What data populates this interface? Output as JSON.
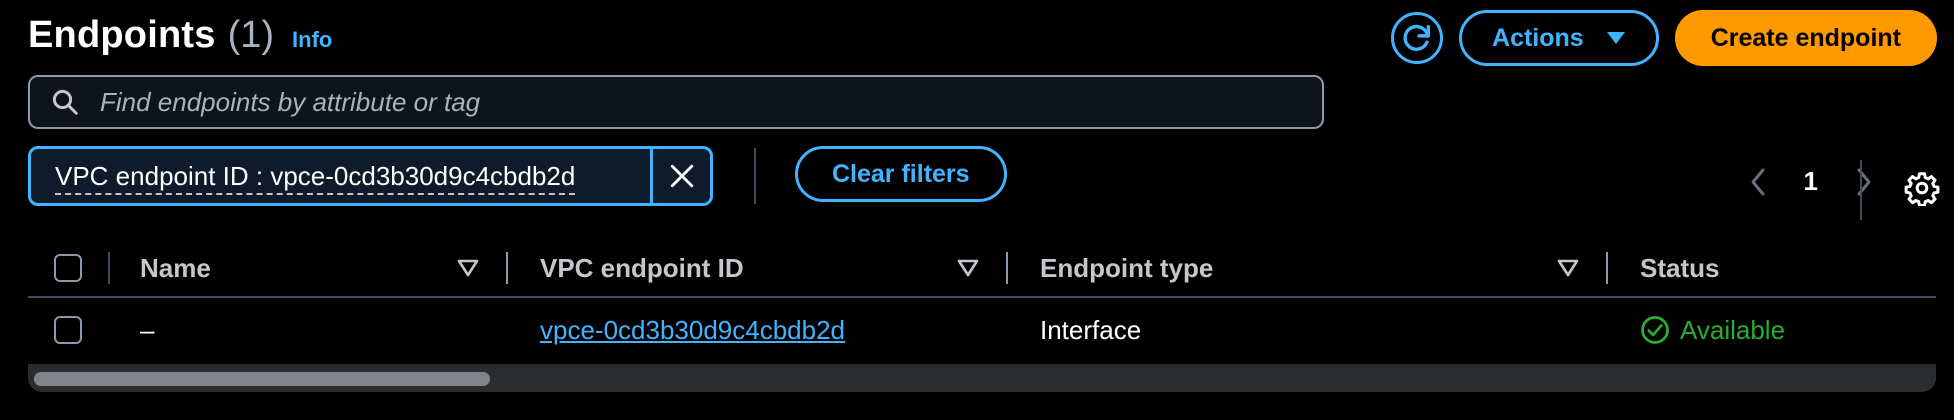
{
  "header": {
    "title": "Endpoints",
    "count": "(1)",
    "info_label": "Info",
    "actions_label": "Actions",
    "create_label": "Create endpoint"
  },
  "search": {
    "placeholder": "Find endpoints by attribute or tag",
    "value": ""
  },
  "filter": {
    "token_label": "VPC endpoint ID : vpce-0cd3b30d9c4cbdb2d",
    "clear_label": "Clear filters"
  },
  "pagination": {
    "current_page": "1"
  },
  "table": {
    "columns": [
      "Name",
      "VPC endpoint ID",
      "Endpoint type",
      "Status"
    ],
    "rows": [
      {
        "name": "–",
        "vpc_endpoint_id": "vpce-0cd3b30d9c4cbdb2d",
        "endpoint_type": "Interface",
        "status": "Available"
      }
    ]
  },
  "colors": {
    "background": "#000000",
    "accent": "#42b4ff",
    "primary_button": "#ff9900",
    "status_success": "#29ad32"
  },
  "icons": [
    "refresh-icon",
    "caret-down-icon",
    "search-icon",
    "close-icon",
    "chevron-left-icon",
    "chevron-right-icon",
    "settings-icon",
    "sort-icon",
    "status-check-icon"
  ]
}
